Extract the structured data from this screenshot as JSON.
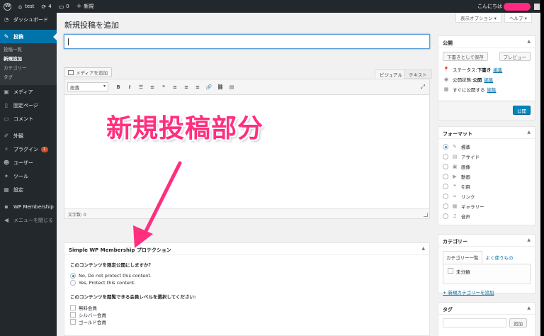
{
  "colors": {
    "accent": "#0073aa",
    "annotation": "#ff2f7f",
    "adminbar": "#23282d",
    "badge": "#d54e21"
  },
  "adminbar": {
    "site_name": "test",
    "updates_count": "4",
    "comments_count": "0",
    "new_label": "新規",
    "greeting": "こんにちは"
  },
  "sidebar": {
    "dashboard": "ダッシュボード",
    "posts": "投稿",
    "posts_sub": [
      "投稿一覧",
      "新規追加",
      "カテゴリー",
      "タグ"
    ],
    "media": "メディア",
    "pages": "固定ページ",
    "comments": "コメント",
    "appearance": "外観",
    "plugins": "プラグイン",
    "plugins_badge": "1",
    "users": "ユーザー",
    "tools": "ツール",
    "settings": "設定",
    "membership": "WP Membership",
    "collapse": "メニューを閉じる"
  },
  "screen_options": {
    "display_label": "表示オプション ▾",
    "help_label": "ヘルプ ▾"
  },
  "page_title": "新規投稿を追加",
  "title_field": {
    "value": ""
  },
  "editor": {
    "add_media": "メディアを追加",
    "tab_visual": "ビジュアル",
    "tab_text": "テキスト",
    "format_select": "段落",
    "toolbar": [
      "B",
      "I",
      "☰",
      "≡",
      "❝",
      "≡",
      "≡",
      "≡",
      "🔗",
      "⛓",
      "▤"
    ],
    "word_count": "文字数: 0"
  },
  "annotation": {
    "text": "新規投稿部分"
  },
  "publish": {
    "title": "公開",
    "save_draft": "下書きとして保存",
    "preview": "プレビュー",
    "status_label": "ステータス: ",
    "status_value": "下書き",
    "visibility_label": "公開状態: ",
    "visibility_value": "公開",
    "schedule_label": "すぐに公開する",
    "edit_link": "編集",
    "publish_button": "公開"
  },
  "format": {
    "title": "フォーマット",
    "options": [
      {
        "label": "標準",
        "icon": "pin-icon",
        "glyph": "✎",
        "selected": true
      },
      {
        "label": "アサイド",
        "icon": "aside-icon",
        "glyph": "▤",
        "selected": false
      },
      {
        "label": "画像",
        "icon": "image-icon",
        "glyph": "▣",
        "selected": false
      },
      {
        "label": "動画",
        "icon": "video-icon",
        "glyph": "▶",
        "selected": false
      },
      {
        "label": "引用",
        "icon": "quote-icon",
        "glyph": "❝",
        "selected": false
      },
      {
        "label": "リンク",
        "icon": "link-icon",
        "glyph": "∞",
        "selected": false
      },
      {
        "label": "ギャラリー",
        "icon": "gallery-icon",
        "glyph": "▦",
        "selected": false
      },
      {
        "label": "音声",
        "icon": "audio-icon",
        "glyph": "♫",
        "selected": false
      }
    ]
  },
  "categories": {
    "title": "カテゴリー",
    "tab_all": "カテゴリー一覧",
    "tab_popular": "よく使うもの",
    "items": [
      "未分類"
    ],
    "add_new": "+ 新規カテゴリーを追加"
  },
  "tags": {
    "title": "タグ",
    "add_button": "追加"
  },
  "swpm": {
    "title": "Simple WP Membership プロテクション",
    "question": "このコンテンツを限定公開にしますか？",
    "options": [
      {
        "label": "No, Do not protect this content.",
        "selected": true
      },
      {
        "label": "Yes, Protect this content.",
        "selected": false
      }
    ],
    "levels_question": "このコンテンツを閲覧できる会員レベルを選択してください:",
    "levels": [
      "無料会員",
      "シルバー会員",
      "ゴールド会員"
    ]
  }
}
